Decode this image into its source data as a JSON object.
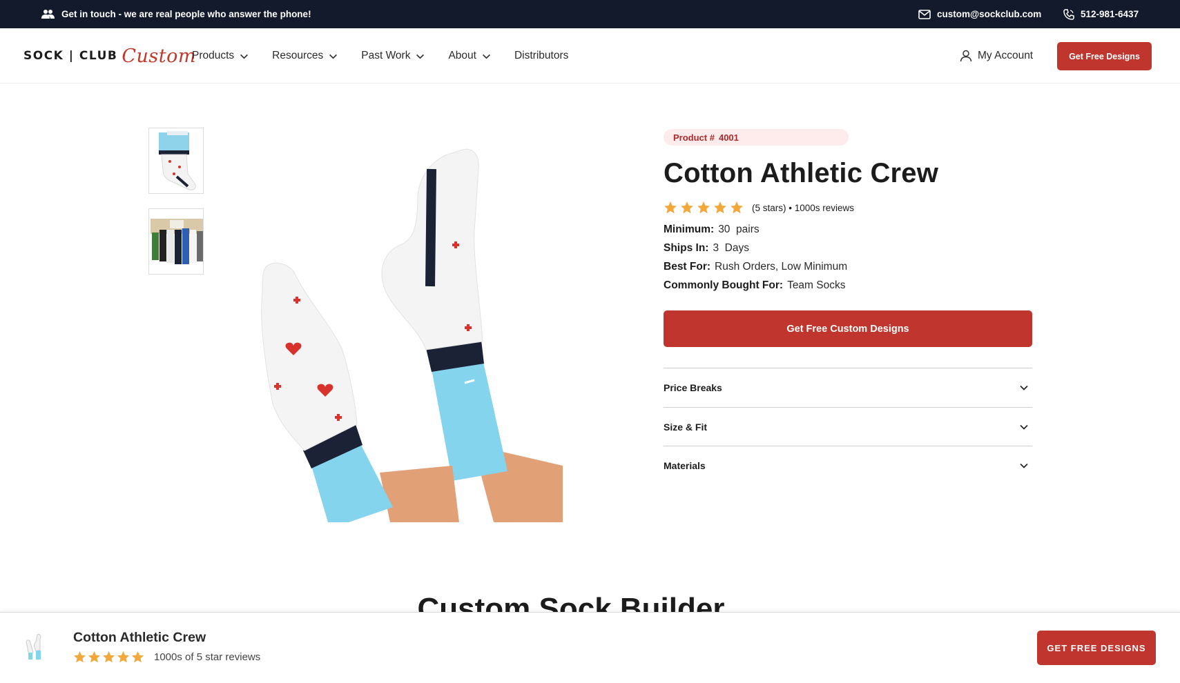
{
  "topbar": {
    "contact_text": "Get in touch - we are real people who answer the phone!",
    "email": "custom@sockclub.com",
    "phone": "512-981-6437"
  },
  "header": {
    "logo": {
      "text_a": "SOCK | CLUB",
      "text_b": "Custom"
    },
    "nav": [
      {
        "label": "Products",
        "has_dropdown": true
      },
      {
        "label": "Resources",
        "has_dropdown": true
      },
      {
        "label": "Past Work",
        "has_dropdown": true
      },
      {
        "label": "About",
        "has_dropdown": true
      },
      {
        "label": "Distributors",
        "has_dropdown": false
      }
    ],
    "account_label": "My Account",
    "cta_label": "Get Free Designs"
  },
  "product": {
    "badge_label": "Product #",
    "badge_number": "4001",
    "title": "Cotton Athletic Crew",
    "rating_stars": 5,
    "rating_text": "(5 stars) • 1000s reviews",
    "specs": [
      {
        "key": "Minimum:",
        "value": "30  pairs"
      },
      {
        "key": "Ships In:",
        "value": "3  Days"
      },
      {
        "key": "Best For:",
        "value": "Rush Orders, Low Minimum"
      },
      {
        "key": "Commonly Bought For:",
        "value": "Team Socks"
      }
    ],
    "cta_label": "Get Free Custom Designs",
    "accordions": [
      {
        "label": "Price Breaks"
      },
      {
        "label": "Size & Fit"
      },
      {
        "label": "Materials"
      }
    ]
  },
  "builder_heading": "Custom Sock Builder",
  "sticky": {
    "name": "Cotton Athletic Crew",
    "review_text": "1000s of 5 star reviews",
    "button_label": "GET FREE DESIGNS"
  },
  "colors": {
    "brand_red": "#c0362f",
    "topbar_bg": "#131a2b",
    "star": "#f2a83b",
    "sock_blue": "#7ed1ec"
  }
}
